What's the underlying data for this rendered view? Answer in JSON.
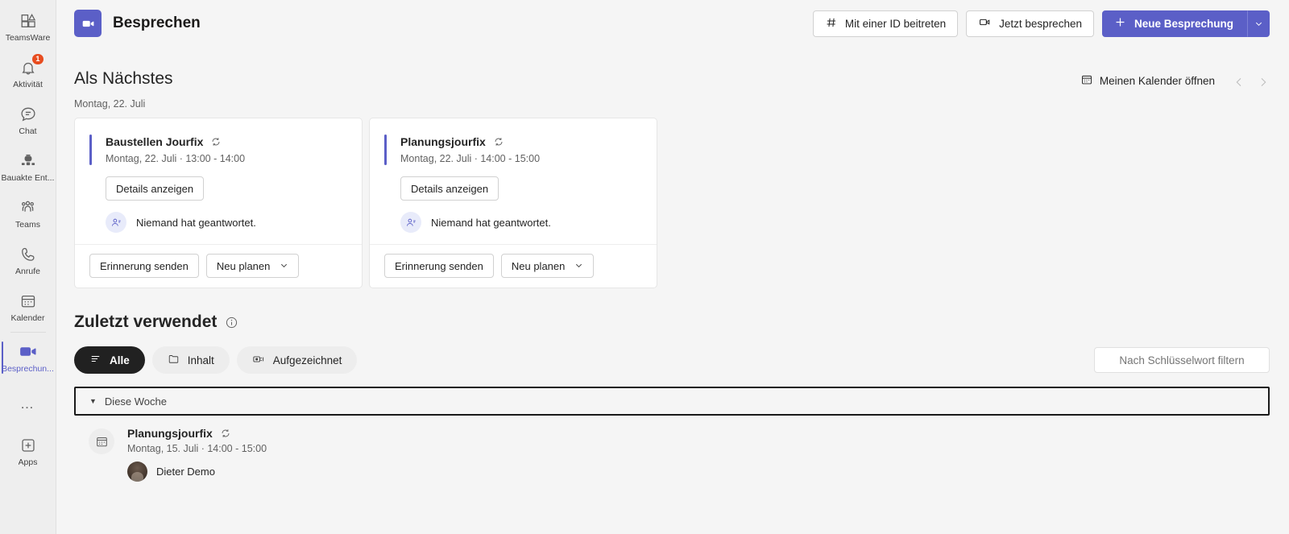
{
  "rail": {
    "items": [
      {
        "label": "TeamsWare",
        "icon": "teamsware-icon",
        "badge": null,
        "active": false
      },
      {
        "label": "Aktivität",
        "icon": "bell-icon",
        "badge": "1",
        "active": false
      },
      {
        "label": "Chat",
        "icon": "chat-icon",
        "badge": null,
        "active": false
      },
      {
        "label": "Bauakte Ent...",
        "icon": "app-robot-icon",
        "badge": null,
        "active": false
      },
      {
        "label": "Teams",
        "icon": "teams-people-icon",
        "badge": null,
        "active": false
      },
      {
        "label": "Anrufe",
        "icon": "phone-icon",
        "badge": null,
        "active": false
      },
      {
        "label": "Kalender",
        "icon": "calendar-icon",
        "badge": null,
        "active": false
      },
      {
        "label": "Besprechun...",
        "icon": "video-camera-icon",
        "badge": null,
        "active": true
      }
    ],
    "more_label": "…",
    "apps_label": "Apps"
  },
  "header": {
    "title": "Besprechen",
    "logo_icon": "video-camera-icon",
    "logo_color": "#5B5FC7",
    "buttons": {
      "join_with_id": "Mit einer ID beitreten",
      "join_with_id_icon": "hash-icon",
      "meet_now": "Jetzt besprechen",
      "meet_now_icon": "video-camera-icon",
      "new_meeting": "Neue Besprechung",
      "new_meeting_icon": "plus-icon",
      "new_meeting_caret_icon": "chevron-down-icon"
    }
  },
  "upnext": {
    "title": "Als Nächstes",
    "calendar_link": "Meinen Kalender öffnen",
    "calendar_link_icon": "calendar-icon",
    "prev_icon": "chevron-left-icon",
    "next_icon": "chevron-right-icon",
    "day": "Montag, 22. Juli",
    "cards": [
      {
        "title": "Baustellen Jourfix",
        "recurring_icon": "recurring-icon",
        "subtitle": "Montag, 22. Juli · 13:00 - 14:00",
        "details_label": "Details anzeigen",
        "response_text": "Niemand hat geantwortet.",
        "response_icon": "people-icon",
        "remind_label": "Erinnerung senden",
        "reschedule_label": "Neu planen",
        "reschedule_caret_icon": "chevron-down-icon",
        "accent": "#5B5FC7"
      },
      {
        "title": "Planungsjourfix",
        "recurring_icon": "recurring-icon",
        "subtitle": "Montag, 22. Juli · 14:00 - 15:00",
        "details_label": "Details anzeigen",
        "response_text": "Niemand hat geantwortet.",
        "response_icon": "people-icon",
        "remind_label": "Erinnerung senden",
        "reschedule_label": "Neu planen",
        "reschedule_caret_icon": "chevron-down-icon",
        "accent": "#5B5FC7"
      }
    ]
  },
  "recent": {
    "title": "Zuletzt verwendet",
    "info_icon": "info-icon",
    "filters": [
      {
        "label": "Alle",
        "icon": "list-icon",
        "active": true
      },
      {
        "label": "Inhalt",
        "icon": "folder-icon",
        "active": false
      },
      {
        "label": "Aufgezeichnet",
        "icon": "recording-icon",
        "active": false
      }
    ],
    "keyword_filter": "Nach Schlüsselwort filtern",
    "group": {
      "label": "Diese Woche",
      "caret_icon": "caret-down-icon"
    },
    "items": [
      {
        "title": "Planungsjourfix",
        "recurring_icon": "recurring-icon",
        "subtitle": "Montag, 15. Juli · 14:00 - 15:00",
        "icon": "calendar-icon",
        "person": "Dieter Demo",
        "person_avatar": "avatar"
      }
    ]
  }
}
